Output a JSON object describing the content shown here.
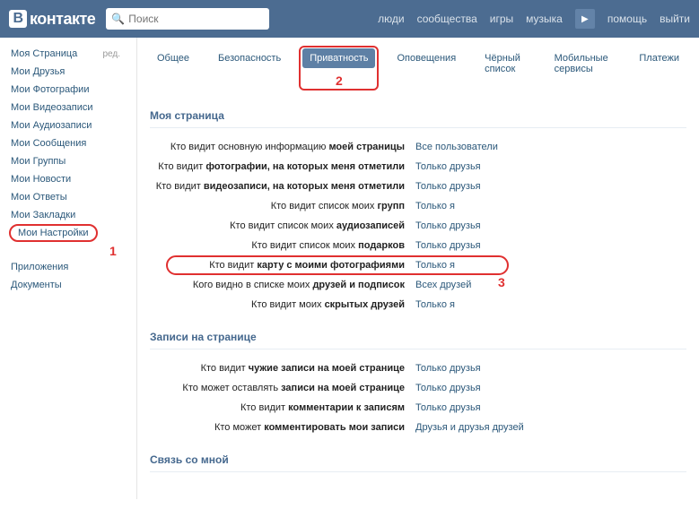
{
  "header": {
    "logo_text": "контакте",
    "search_placeholder": "Поиск",
    "nav": {
      "people": "люди",
      "communities": "сообщества",
      "games": "игры",
      "music": "музыка",
      "help": "помощь",
      "logout": "выйти"
    }
  },
  "sidebar": {
    "items": [
      "Моя Страница",
      "Мои Друзья",
      "Мои Фотографии",
      "Мои Видеозаписи",
      "Мои Аудиозаписи",
      "Мои Сообщения",
      "Мои Группы",
      "Мои Новости",
      "Мои Ответы",
      "Мои Закладки",
      "Мои Настройки"
    ],
    "edit": "ред.",
    "extra": [
      "Приложения",
      "Документы"
    ]
  },
  "tabs": {
    "general": "Общее",
    "security": "Безопасность",
    "privacy": "Приватность",
    "notifications": "Оповещения",
    "blacklist": "Чёрный список",
    "mobile": "Мобильные сервисы",
    "payments": "Платежи"
  },
  "annotations": {
    "a1": "1",
    "a2": "2",
    "a3": "3"
  },
  "sections": {
    "my_page": {
      "title": "Моя страница",
      "rows": [
        {
          "pre": "Кто видит основную информацию ",
          "bold": "моей страницы",
          "value": "Все пользователи"
        },
        {
          "pre": "Кто видит ",
          "bold": "фотографии, на которых меня отметили",
          "value": "Только друзья"
        },
        {
          "pre": "Кто видит ",
          "bold": "видеозаписи, на которых меня отметили",
          "value": "Только друзья"
        },
        {
          "pre": "Кто видит список моих ",
          "bold": "групп",
          "value": "Только я"
        },
        {
          "pre": "Кто видит список моих ",
          "bold": "аудиозаписей",
          "value": "Только друзья"
        },
        {
          "pre": "Кто видит список моих ",
          "bold": "подарков",
          "value": "Только друзья"
        },
        {
          "pre": "Кто видит ",
          "bold": "карту с моими фотографиями",
          "value": "Только я"
        },
        {
          "pre": "Кого видно в списке моих ",
          "bold": "друзей и подписок",
          "value": "Всех друзей"
        },
        {
          "pre": "Кто видит моих ",
          "bold": "скрытых друзей",
          "value": "Только я"
        }
      ]
    },
    "wall": {
      "title": "Записи на странице",
      "rows": [
        {
          "pre": "Кто видит ",
          "bold": "чужие записи на моей странице",
          "value": "Только друзья"
        },
        {
          "pre": "Кто может оставлять ",
          "bold": "записи на моей странице",
          "value": "Только друзья"
        },
        {
          "pre": "Кто видит ",
          "bold": "комментарии к записям",
          "value": "Только друзья"
        },
        {
          "pre": "Кто может ",
          "bold": "комментировать мои записи",
          "value": "Друзья и друзья друзей"
        }
      ]
    },
    "contact": {
      "title": "Связь со мной"
    }
  }
}
